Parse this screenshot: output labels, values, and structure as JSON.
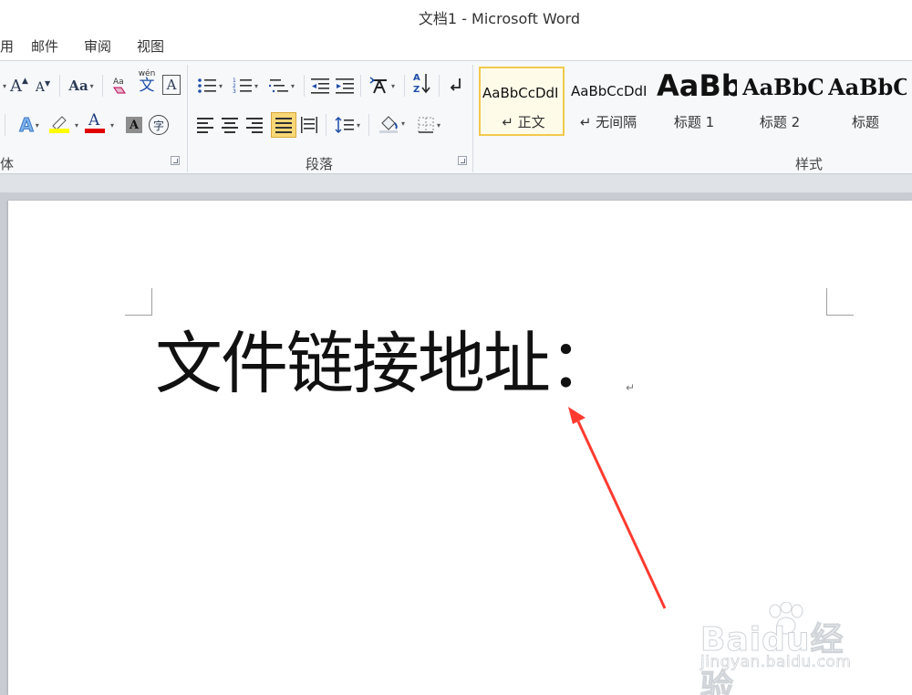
{
  "window": {
    "title": "文档1  -  Microsoft Word"
  },
  "menu": {
    "tabs": [
      "用",
      "邮件",
      "审阅",
      "视图"
    ]
  },
  "ribbon": {
    "groups": {
      "font": "体",
      "paragraph": "段落",
      "styles": "样式"
    },
    "font_buttons": {
      "grow": "A",
      "shrink": "A",
      "case": "Aa",
      "phonetic_top": "wén",
      "phonetic_char": "文",
      "charborder": "A",
      "effects": "A",
      "fontcolor": "A",
      "shading": "A",
      "enclose": "字"
    },
    "highlight_color": "#ffff00",
    "font_color": "#e00000",
    "styles": [
      {
        "sample": "AaBbCcDdI",
        "name": "↵ 正文",
        "selected": true
      },
      {
        "sample": "AaBbCcDdI",
        "name": "↵ 无间隔",
        "selected": false
      },
      {
        "sample": "AaBb",
        "name": "标题 1",
        "selected": false
      },
      {
        "sample": "AaBbC",
        "name": "标题 2",
        "selected": false
      },
      {
        "sample": "AaBbC",
        "name": "标题",
        "selected": false
      }
    ]
  },
  "document": {
    "text": "文件链接地址：",
    "paragraph_mark": "↵"
  },
  "annotation": {
    "arrow_color": "#ff3b30"
  },
  "watermark": {
    "main": "Baidu经验",
    "sub": "jingyan.baidu.com"
  }
}
